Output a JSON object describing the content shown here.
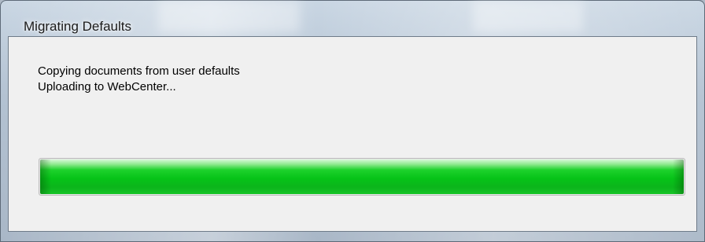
{
  "window": {
    "title": "Migrating Defaults"
  },
  "message": {
    "line1": "Copying documents from user defaults",
    "line2": "Uploading to WebCenter..."
  },
  "progress": {
    "value": 1.0,
    "color": "#06c318"
  }
}
